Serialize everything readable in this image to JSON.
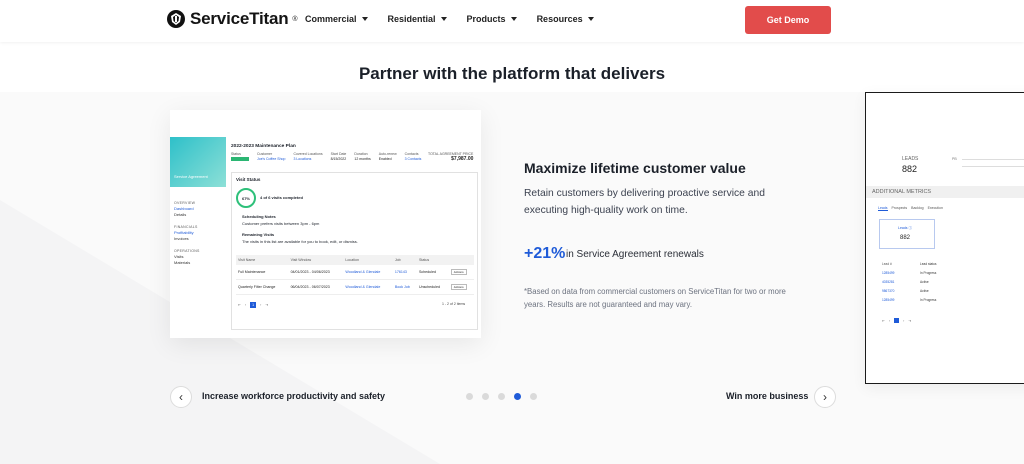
{
  "header": {
    "brand": "ServiceTitan",
    "trademark": "®",
    "nav": [
      "Commercial",
      "Residential",
      "Products",
      "Resources"
    ],
    "cta_label": "Get Demo"
  },
  "headline": "Partner with the platform that delivers",
  "card": {
    "hero_label": "Service Agreement",
    "title": "2022-2023 Maintenance Plan",
    "info": [
      {
        "k": "Status",
        "v": ""
      },
      {
        "k": "Customer",
        "v": "Joe's Coffee Shop"
      },
      {
        "k": "Covered Locations",
        "v": "3 Locations"
      },
      {
        "k": "Start Date",
        "v": "8/15/2022"
      },
      {
        "k": "Duration",
        "v": "12 months"
      },
      {
        "k": "Auto-renew",
        "v": "Enabled"
      },
      {
        "k": "Contacts",
        "v": "3 Contacts"
      }
    ],
    "total_label": "TOTAL AGREEMENT PRICE",
    "total_value": "$7,987.00",
    "side": {
      "overview": "OVERVIEW",
      "dashboard": "Dashboard",
      "details": "Details",
      "financials": "FINANCIALS",
      "profitability": "Profitability",
      "invoices": "Invoices",
      "operations": "OPERATIONS",
      "visits": "Visits",
      "materials": "Materials"
    },
    "visit_status": "Visit Status",
    "pct": "67%",
    "completed": "4 of 6 visits completed",
    "sched_title": "Scheduling Notes",
    "sched_text": "Customer prefers visits between 3pm - 6pm",
    "remain_title": "Remaining Visits",
    "remain_text": "The visits in this list are available for you to book, edit, or dismiss.",
    "table_headers": [
      "Visit Name",
      "Visit Window",
      "Location",
      "Job",
      "Status",
      ""
    ],
    "rows": [
      [
        "Full Maintenance",
        "04/01/2023 - 04/06/2023",
        "Woodland & Glendale",
        "176143",
        "Scheduled",
        "Actions"
      ],
      [
        "Quarterly Filter Change",
        "06/04/2023 - 06/07/2023",
        "Woodland & Glendale",
        "Book Job",
        "Unscheduled",
        "Actions"
      ]
    ],
    "pager_current": "1",
    "pager_info": "1 - 2 of 2 items"
  },
  "feature": {
    "title": "Maximize lifetime customer value",
    "desc": "Retain customers by delivering proactive service and executing high-quality work on time.",
    "stat_value": "+21%",
    "stat_label": "in Service Agreement renewals",
    "footnote": "*Based on data from commercial customers on ServiceTitan for two or more years. Results are not guaranteed and may vary."
  },
  "preview": {
    "leads_label": "LEADS",
    "leads_value": "882",
    "pb_label": "PB",
    "addl": "ADDITIONAL METRICS",
    "tabs": [
      "Leads",
      "Prospects",
      "Backlog",
      "Execution"
    ],
    "box_label": "Leads ⓘ",
    "box_value": "882",
    "rows": [
      [
        "Lead #",
        "Lead status"
      ],
      [
        "1285499",
        "In Progress"
      ],
      [
        "4035281",
        "Active"
      ],
      [
        "9867370",
        "Active"
      ],
      [
        "1285499",
        "In Progress"
      ]
    ],
    "pager_current": "1"
  },
  "carousel": {
    "prev_label": "Increase workforce productivity and safety",
    "next_label": "Win more business",
    "dot_count": 5,
    "active_dot": 4
  },
  "colors": {
    "brand_blue": "#1f5bd8",
    "cta_red": "#e24c4b",
    "status_green": "#2bb673"
  }
}
